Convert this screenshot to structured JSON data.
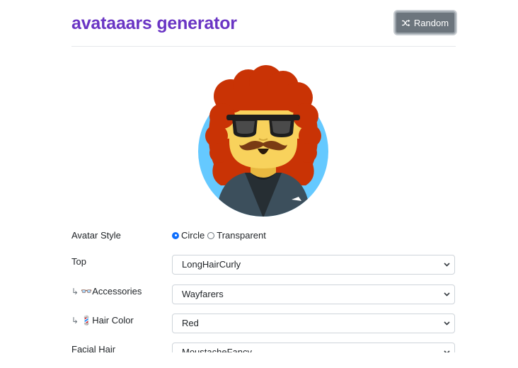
{
  "header": {
    "title": "avataaars generator",
    "random_label": "Random"
  },
  "colors": {
    "title": "#6a35c4",
    "button": "#6c757d",
    "hair": "#c93305",
    "skin": "#f8d25c",
    "background_circle": "#65c9ff",
    "clothing": "#3c4f5c"
  },
  "form": {
    "avatar_style": {
      "label": "Avatar Style",
      "options": [
        "Circle",
        "Transparent"
      ],
      "selected": "Circle"
    },
    "top": {
      "label": "Top",
      "value": "LongHairCurly"
    },
    "accessories": {
      "prefix": "↳",
      "icon": "👓",
      "label": "Accessories",
      "value": "Wayfarers"
    },
    "hair_color": {
      "prefix": "↳",
      "icon": "💈",
      "label": "Hair Color",
      "value": "Red"
    },
    "facial_hair": {
      "label": "Facial Hair",
      "value": "MoustacheFancy"
    }
  }
}
